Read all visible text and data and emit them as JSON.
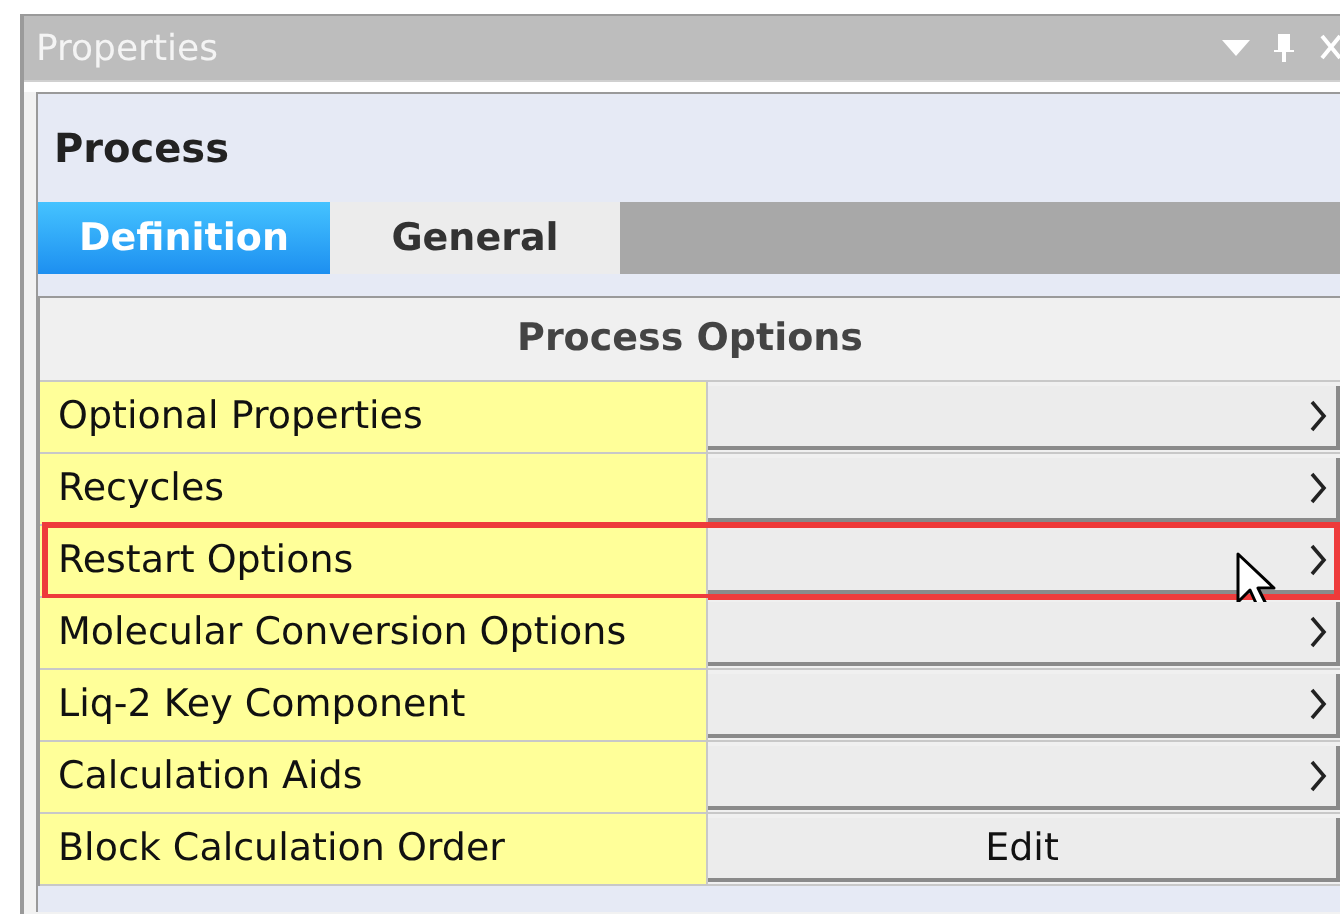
{
  "window": {
    "title": "Properties"
  },
  "header": {
    "title": "Process"
  },
  "tabs": [
    {
      "label": "Definition",
      "selected": true
    },
    {
      "label": "General",
      "selected": false
    }
  ],
  "section": {
    "title": "Process Options"
  },
  "rows": [
    {
      "label": "Optional Properties",
      "kind": "arrow",
      "highlighted": false
    },
    {
      "label": "Recycles",
      "kind": "arrow",
      "highlighted": false
    },
    {
      "label": "Restart Options",
      "kind": "arrow",
      "highlighted": true
    },
    {
      "label": "Molecular Conversion Options",
      "kind": "arrow",
      "highlighted": false
    },
    {
      "label": "Liq-2 Key Component",
      "kind": "arrow",
      "highlighted": false
    },
    {
      "label": "Calculation Aids",
      "kind": "arrow",
      "highlighted": false
    },
    {
      "label": "Block Calculation Order",
      "kind": "text",
      "button": "Edit",
      "highlighted": false
    }
  ]
}
